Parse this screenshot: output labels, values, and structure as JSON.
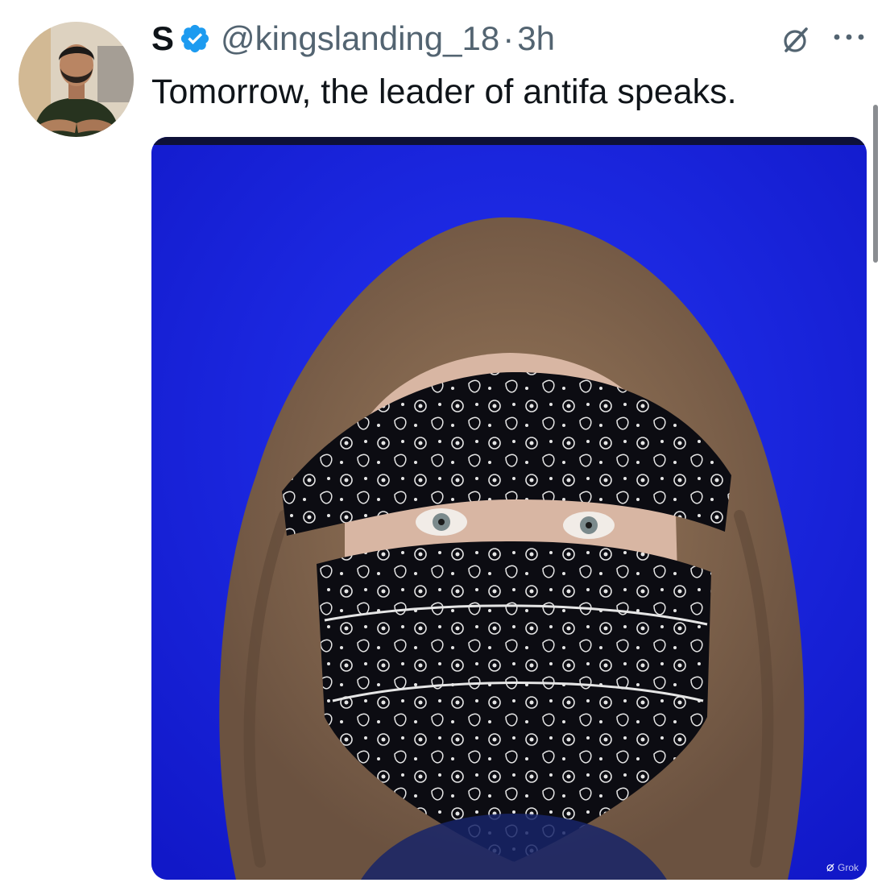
{
  "tweet": {
    "display_name": "S",
    "verified": true,
    "verified_icon": "verified-badge-icon",
    "verified_color": "#1d9bf0",
    "handle": "@kingslanding_18",
    "separator": "·",
    "time": "3h",
    "text": "Tomorrow, the leader of antifa speaks.",
    "grok_icon": "grok-icon",
    "more_icon": "more-horizontal-icon"
  },
  "media": {
    "watermark": "Grok",
    "background_color": "#1522e0"
  },
  "colors": {
    "text": "#0f1419",
    "secondary_text": "#536471",
    "accent": "#1d9bf0"
  }
}
